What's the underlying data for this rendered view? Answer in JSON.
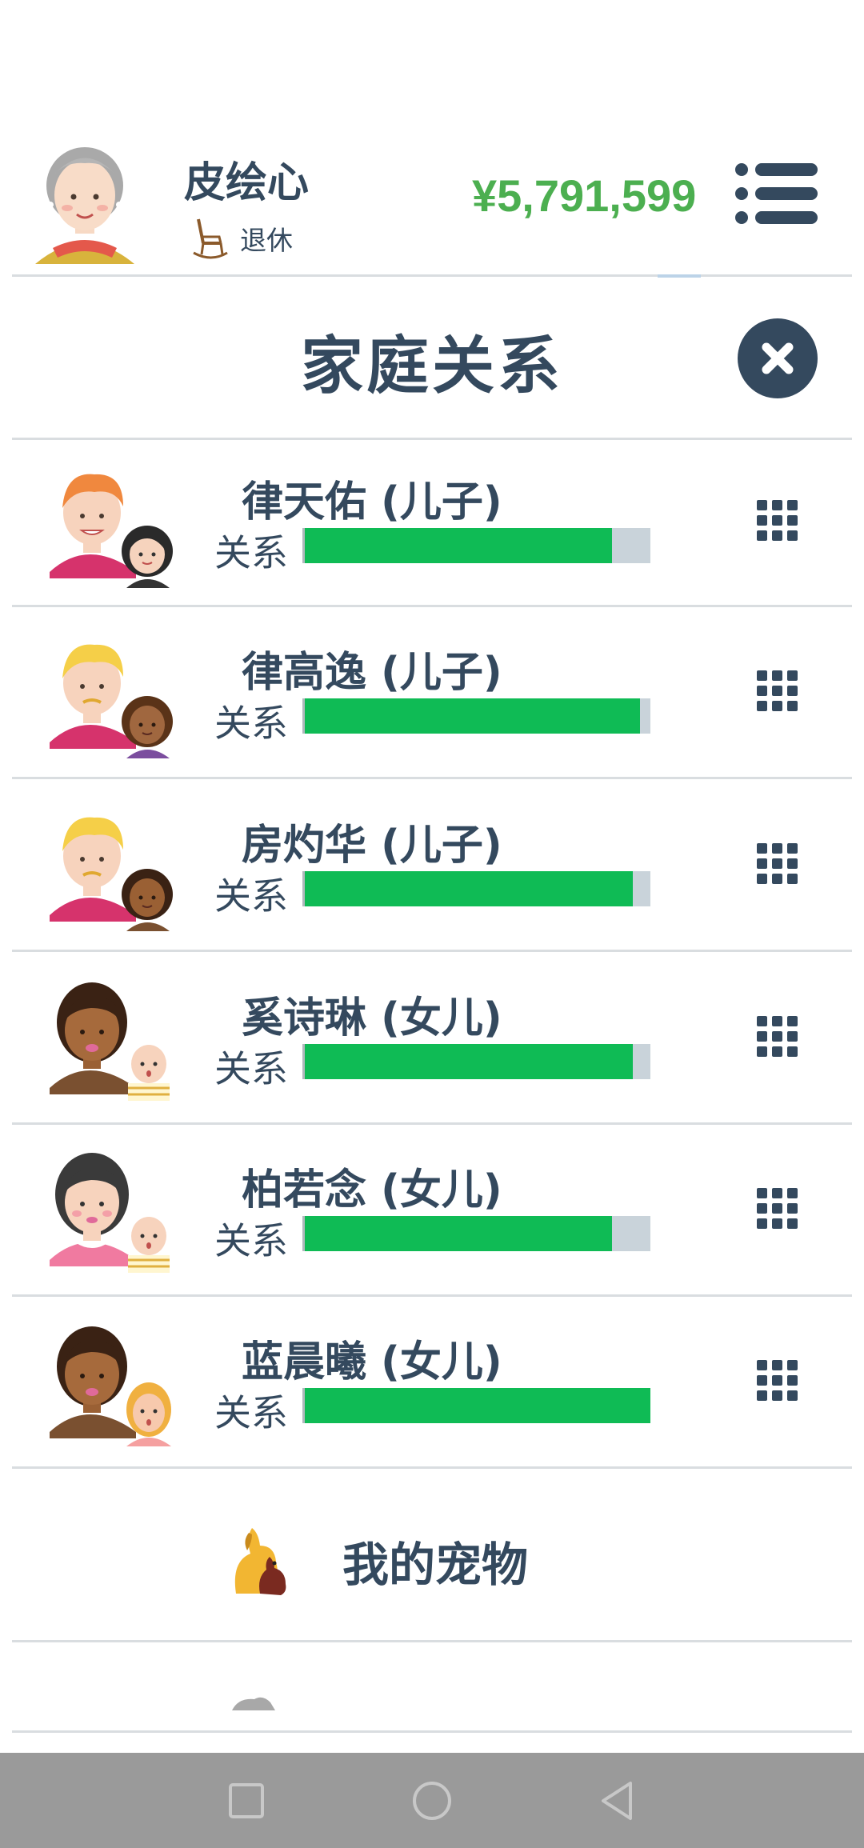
{
  "player": {
    "name": "皮绘心",
    "status": "退休",
    "money": "¥5,791,599"
  },
  "dialog": {
    "title": "家庭关系"
  },
  "relationship_label": "关系",
  "family": [
    {
      "name": "律天佑 (儿子)",
      "relationship": 0.89
    },
    {
      "name": "律高逸 (儿子)",
      "relationship": 0.97
    },
    {
      "name": "房灼华 (儿子)",
      "relationship": 0.95
    },
    {
      "name": "奚诗琳 (女儿)",
      "relationship": 0.95
    },
    {
      "name": "柏若念 (女儿)",
      "relationship": 0.89
    },
    {
      "name": "蓝晨曦 (女儿)",
      "relationship": 1.0
    }
  ],
  "pets": {
    "label": "我的宠物"
  },
  "colors": {
    "primary": "#34495e",
    "money": "#4caf50",
    "bar_fill": "#0fbb55",
    "bar_track": "#c9d3da"
  }
}
